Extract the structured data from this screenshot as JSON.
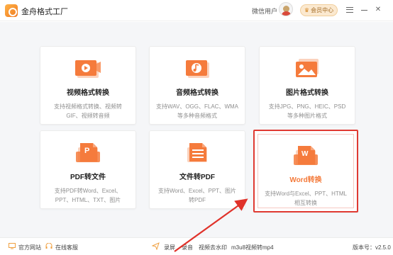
{
  "app": {
    "title": "金舟格式工厂"
  },
  "header": {
    "user_name": "微信用户",
    "vip_label": "会员中心"
  },
  "cards": [
    {
      "title": "视频格式转换",
      "desc": "支持视频格式转换、视频转GIF、视频转音频",
      "icon": "video-icon"
    },
    {
      "title": "音频格式转换",
      "desc": "支持WAV、OGG、FLAC、WMA等多种音频格式",
      "icon": "audio-icon"
    },
    {
      "title": "图片格式转换",
      "desc": "支持JPG、PNG、HEIC、PSD等多种图片格式",
      "icon": "image-icon"
    },
    {
      "title": "PDF转文件",
      "desc": "支持PDF转Word、Excel、PPT、HTML、TXT、图片",
      "icon": "pdf-icon",
      "badge": "P"
    },
    {
      "title": "文件转PDF",
      "desc": "支持Word、Excel、PPT、图片转PDF",
      "icon": "document-icon"
    },
    {
      "title": "Word转换",
      "desc": "支持Word与Excel、PPT、HTML相互转换",
      "icon": "word-icon",
      "badge": "W"
    }
  ],
  "footer": {
    "website": "官方网站",
    "service": "在线客服",
    "record": "录屏",
    "audio_record": "录音",
    "watermark": "视频去水印",
    "m3u8": "m3u8视频转mp4",
    "version": "版本号：v2.5.0"
  },
  "colors": {
    "accent": "#f47a3a",
    "highlight_border": "#e03a32",
    "icon_orange": "#f57b3c"
  }
}
